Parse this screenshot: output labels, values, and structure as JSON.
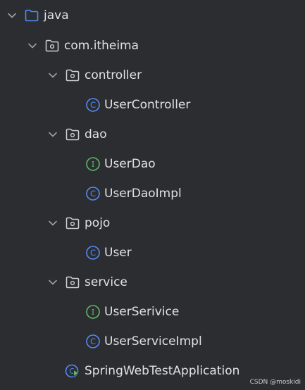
{
  "tree": {
    "java": {
      "label": "java",
      "icon": "source-folder-icon"
    },
    "package": {
      "label": "com.itheima",
      "icon": "package-icon"
    },
    "controller": {
      "label": "controller",
      "icon": "folder-icon"
    },
    "user_controller": {
      "label": "UserController",
      "icon": "class-icon",
      "badge": "C"
    },
    "dao": {
      "label": "dao",
      "icon": "folder-icon"
    },
    "user_dao": {
      "label": "UserDao",
      "icon": "interface-icon",
      "badge": "I"
    },
    "user_dao_impl": {
      "label": "UserDaoImpl",
      "icon": "class-icon",
      "badge": "C"
    },
    "pojo": {
      "label": "pojo",
      "icon": "folder-icon"
    },
    "user": {
      "label": "User",
      "icon": "class-icon",
      "badge": "C"
    },
    "service": {
      "label": "service",
      "icon": "folder-icon"
    },
    "user_service": {
      "label": "UserSerivice",
      "icon": "interface-icon",
      "badge": "I"
    },
    "user_service_impl": {
      "label": "UserServiceImpl",
      "icon": "class-icon",
      "badge": "C"
    },
    "app": {
      "label": "SpringWebTestApplication",
      "icon": "spring-boot-class-icon",
      "badge": "C"
    }
  },
  "watermark": "CSDN @moskidi",
  "colors": {
    "background": "#2b2d30",
    "text": "#dfe1e5",
    "chevron": "#9da0a8",
    "folder_outline": "#ced0d6",
    "source_folder": "#548af7",
    "class_icon": "#548af7",
    "interface_icon": "#5fb865",
    "spring_green": "#5fb865"
  }
}
